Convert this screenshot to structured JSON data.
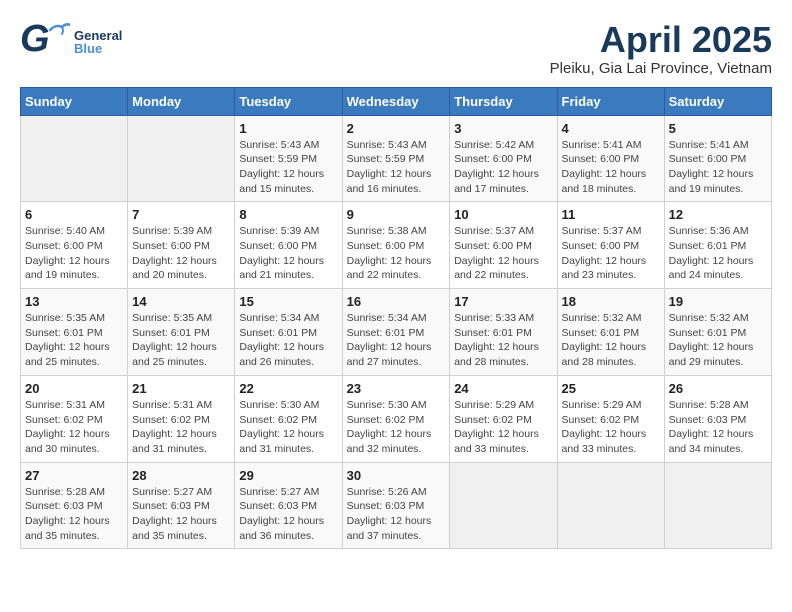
{
  "header": {
    "logo": {
      "general": "General",
      "blue": "Blue"
    },
    "title": "April 2025",
    "subtitle": "Pleiku, Gia Lai Province, Vietnam"
  },
  "calendar": {
    "days_of_week": [
      "Sunday",
      "Monday",
      "Tuesday",
      "Wednesday",
      "Thursday",
      "Friday",
      "Saturday"
    ],
    "weeks": [
      [
        {
          "day": "",
          "info": ""
        },
        {
          "day": "",
          "info": ""
        },
        {
          "day": "1",
          "info": "Sunrise: 5:43 AM\nSunset: 5:59 PM\nDaylight: 12 hours and 15 minutes."
        },
        {
          "day": "2",
          "info": "Sunrise: 5:43 AM\nSunset: 5:59 PM\nDaylight: 12 hours and 16 minutes."
        },
        {
          "day": "3",
          "info": "Sunrise: 5:42 AM\nSunset: 6:00 PM\nDaylight: 12 hours and 17 minutes."
        },
        {
          "day": "4",
          "info": "Sunrise: 5:41 AM\nSunset: 6:00 PM\nDaylight: 12 hours and 18 minutes."
        },
        {
          "day": "5",
          "info": "Sunrise: 5:41 AM\nSunset: 6:00 PM\nDaylight: 12 hours and 19 minutes."
        }
      ],
      [
        {
          "day": "6",
          "info": "Sunrise: 5:40 AM\nSunset: 6:00 PM\nDaylight: 12 hours and 19 minutes."
        },
        {
          "day": "7",
          "info": "Sunrise: 5:39 AM\nSunset: 6:00 PM\nDaylight: 12 hours and 20 minutes."
        },
        {
          "day": "8",
          "info": "Sunrise: 5:39 AM\nSunset: 6:00 PM\nDaylight: 12 hours and 21 minutes."
        },
        {
          "day": "9",
          "info": "Sunrise: 5:38 AM\nSunset: 6:00 PM\nDaylight: 12 hours and 22 minutes."
        },
        {
          "day": "10",
          "info": "Sunrise: 5:37 AM\nSunset: 6:00 PM\nDaylight: 12 hours and 22 minutes."
        },
        {
          "day": "11",
          "info": "Sunrise: 5:37 AM\nSunset: 6:00 PM\nDaylight: 12 hours and 23 minutes."
        },
        {
          "day": "12",
          "info": "Sunrise: 5:36 AM\nSunset: 6:01 PM\nDaylight: 12 hours and 24 minutes."
        }
      ],
      [
        {
          "day": "13",
          "info": "Sunrise: 5:35 AM\nSunset: 6:01 PM\nDaylight: 12 hours and 25 minutes."
        },
        {
          "day": "14",
          "info": "Sunrise: 5:35 AM\nSunset: 6:01 PM\nDaylight: 12 hours and 25 minutes."
        },
        {
          "day": "15",
          "info": "Sunrise: 5:34 AM\nSunset: 6:01 PM\nDaylight: 12 hours and 26 minutes."
        },
        {
          "day": "16",
          "info": "Sunrise: 5:34 AM\nSunset: 6:01 PM\nDaylight: 12 hours and 27 minutes."
        },
        {
          "day": "17",
          "info": "Sunrise: 5:33 AM\nSunset: 6:01 PM\nDaylight: 12 hours and 28 minutes."
        },
        {
          "day": "18",
          "info": "Sunrise: 5:32 AM\nSunset: 6:01 PM\nDaylight: 12 hours and 28 minutes."
        },
        {
          "day": "19",
          "info": "Sunrise: 5:32 AM\nSunset: 6:01 PM\nDaylight: 12 hours and 29 minutes."
        }
      ],
      [
        {
          "day": "20",
          "info": "Sunrise: 5:31 AM\nSunset: 6:02 PM\nDaylight: 12 hours and 30 minutes."
        },
        {
          "day": "21",
          "info": "Sunrise: 5:31 AM\nSunset: 6:02 PM\nDaylight: 12 hours and 31 minutes."
        },
        {
          "day": "22",
          "info": "Sunrise: 5:30 AM\nSunset: 6:02 PM\nDaylight: 12 hours and 31 minutes."
        },
        {
          "day": "23",
          "info": "Sunrise: 5:30 AM\nSunset: 6:02 PM\nDaylight: 12 hours and 32 minutes."
        },
        {
          "day": "24",
          "info": "Sunrise: 5:29 AM\nSunset: 6:02 PM\nDaylight: 12 hours and 33 minutes."
        },
        {
          "day": "25",
          "info": "Sunrise: 5:29 AM\nSunset: 6:02 PM\nDaylight: 12 hours and 33 minutes."
        },
        {
          "day": "26",
          "info": "Sunrise: 5:28 AM\nSunset: 6:03 PM\nDaylight: 12 hours and 34 minutes."
        }
      ],
      [
        {
          "day": "27",
          "info": "Sunrise: 5:28 AM\nSunset: 6:03 PM\nDaylight: 12 hours and 35 minutes."
        },
        {
          "day": "28",
          "info": "Sunrise: 5:27 AM\nSunset: 6:03 PM\nDaylight: 12 hours and 35 minutes."
        },
        {
          "day": "29",
          "info": "Sunrise: 5:27 AM\nSunset: 6:03 PM\nDaylight: 12 hours and 36 minutes."
        },
        {
          "day": "30",
          "info": "Sunrise: 5:26 AM\nSunset: 6:03 PM\nDaylight: 12 hours and 37 minutes."
        },
        {
          "day": "",
          "info": ""
        },
        {
          "day": "",
          "info": ""
        },
        {
          "day": "",
          "info": ""
        }
      ]
    ]
  }
}
